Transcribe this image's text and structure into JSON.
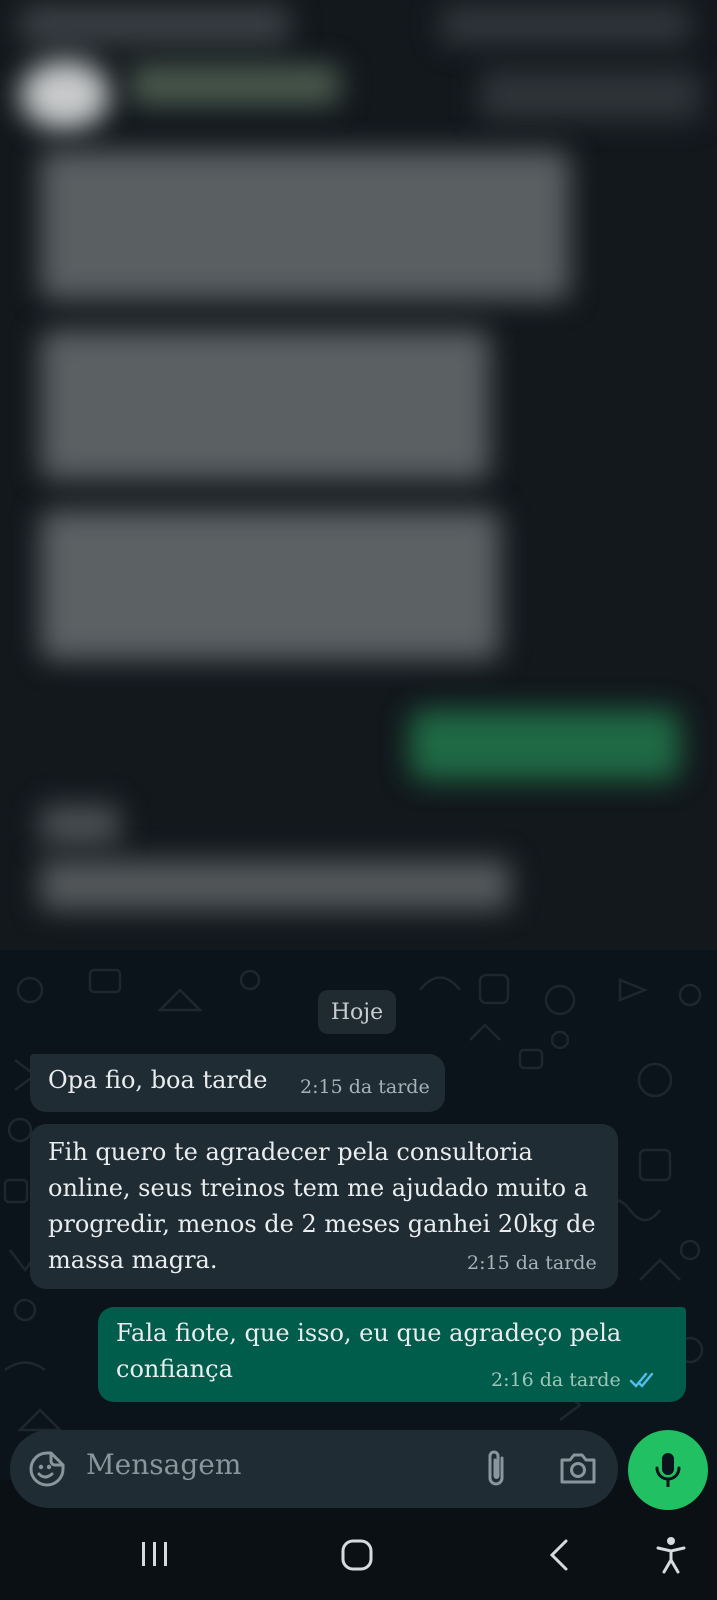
{
  "chat": {
    "date_chip": "Hoje",
    "messages": [
      {
        "direction": "incoming",
        "text": "Opa fio, boa tarde",
        "time": "2:15 da tarde"
      },
      {
        "direction": "incoming",
        "text": "Fih quero te agradecer pela consultoria online, seus treinos tem me ajudado muito a progredir, menos de 2 meses ganhei 20kg de massa magra.",
        "time": "2:15 da tarde"
      },
      {
        "direction": "outgoing",
        "text": "Fala fiote, que isso, eu que agradeço pela confiança",
        "time": "2:16 da tarde",
        "status": "read"
      }
    ]
  },
  "composer": {
    "placeholder": "Mensagem",
    "icons": [
      "emoji-icon",
      "attach-icon",
      "camera-icon",
      "mic-icon"
    ]
  },
  "navigation": {
    "icons": [
      "recent-apps-icon",
      "home-icon",
      "back-icon",
      "accessibility-icon"
    ]
  },
  "colors": {
    "incoming_bubble": "#202c33",
    "outgoing_bubble": "#005c4b",
    "mic_button": "#21c063",
    "read_ticks": "#53bdeb"
  }
}
